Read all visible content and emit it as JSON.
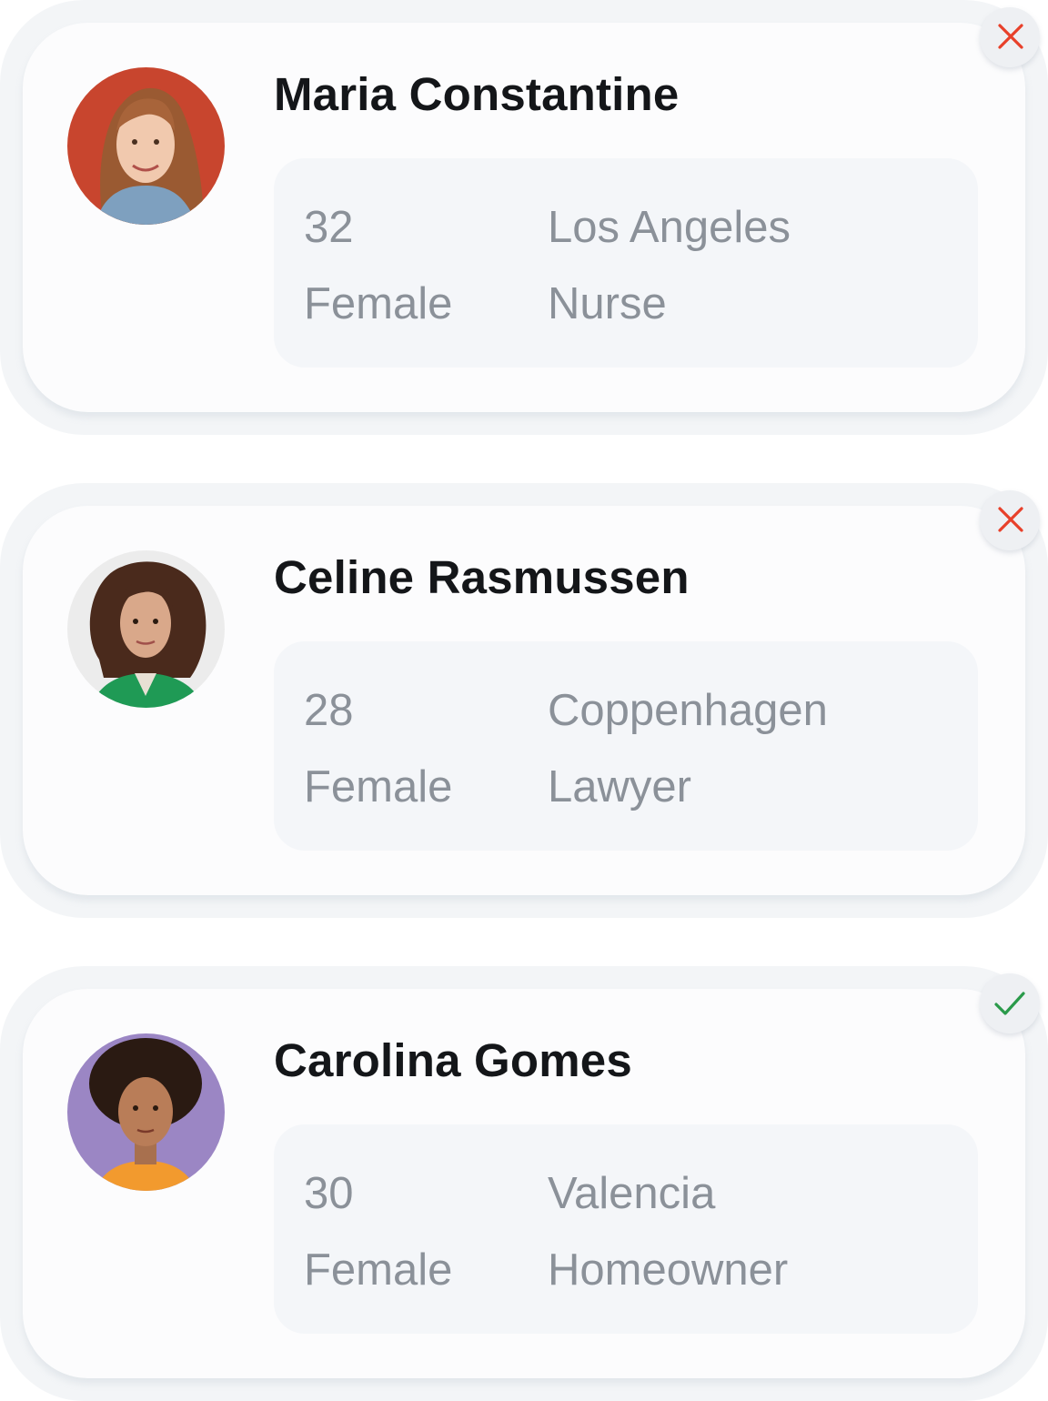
{
  "profiles": [
    {
      "name": "Maria Constantine",
      "age": "32",
      "gender": "Female",
      "city": "Los Angeles",
      "occupation": "Nurse",
      "status_icon": "close-icon",
      "status_color": "#e8402a",
      "avatar_bg": "#c8452e"
    },
    {
      "name": "Celine Rasmussen",
      "age": "28",
      "gender": "Female",
      "city": "Coppenhagen",
      "occupation": "Lawyer",
      "status_icon": "close-icon",
      "status_color": "#e8402a",
      "avatar_bg": "#ececec"
    },
    {
      "name": "Carolina Gomes",
      "age": "30",
      "gender": "Female",
      "city": "Valencia",
      "occupation": "Homeowner",
      "status_icon": "check-icon",
      "status_color": "#2a9a4a",
      "avatar_bg": "#9b86c4"
    }
  ]
}
